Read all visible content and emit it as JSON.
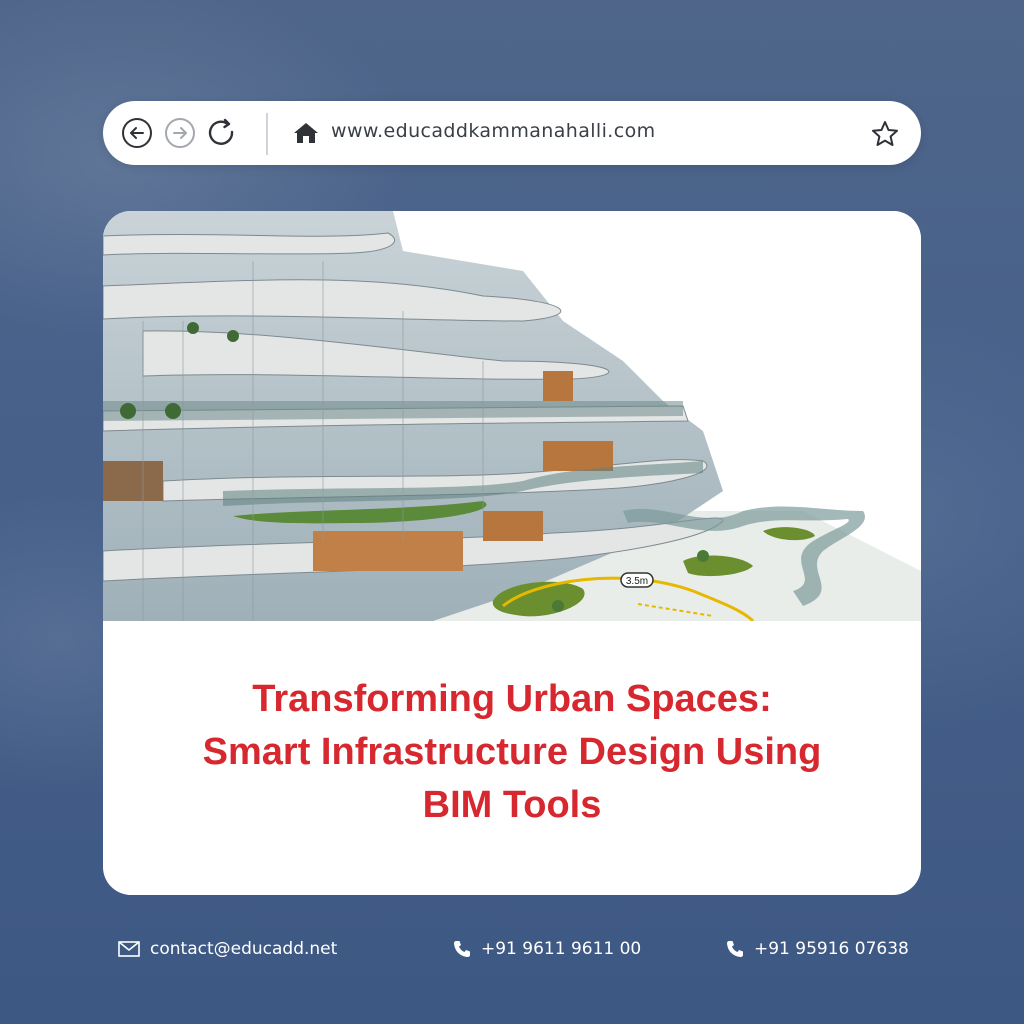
{
  "browser": {
    "url": "www.educaddkammanahalli.com",
    "icons": [
      "back-arrow-icon",
      "forward-arrow-icon",
      "reload-icon",
      "home-icon",
      "star-icon"
    ]
  },
  "hero": {
    "image_label": "3.5m"
  },
  "headline": {
    "line1": "Transforming Urban Spaces:",
    "line2": "Smart Infrastructure Design Using",
    "line3": "BIM Tools"
  },
  "footer": {
    "email": "contact@educadd.net",
    "phone1": "+91 9611 9611 00",
    "phone2": "+91 95916 07638",
    "icons": [
      "mail-icon",
      "phone-icon",
      "phone-icon"
    ]
  },
  "colors": {
    "accent": "#d6282e",
    "background": "#46608a",
    "card": "#ffffff"
  }
}
